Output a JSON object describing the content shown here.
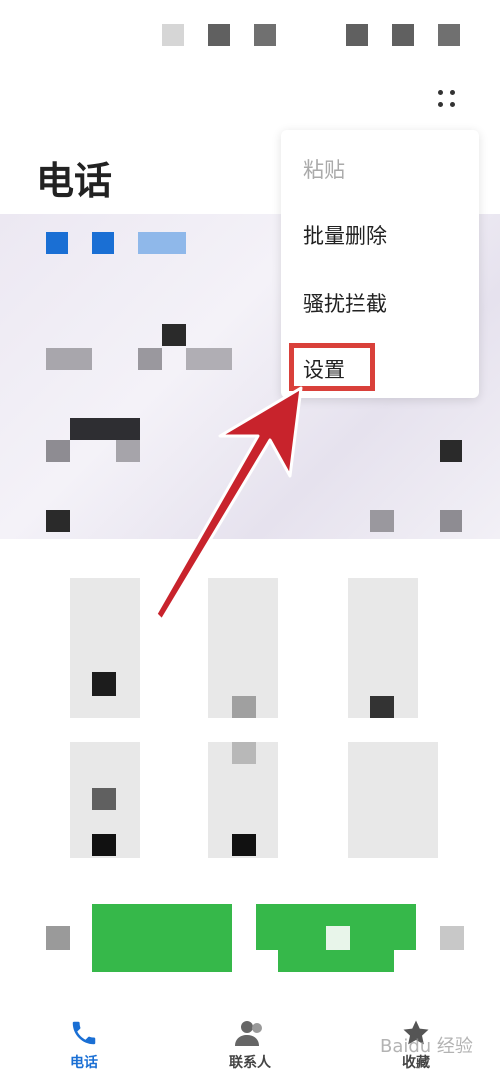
{
  "header": {
    "title": "电话"
  },
  "menu": {
    "items": [
      {
        "label": "粘贴",
        "enabled": false
      },
      {
        "label": "批量删除",
        "enabled": true
      },
      {
        "label": "骚扰拦截",
        "enabled": true
      },
      {
        "label": "设置",
        "enabled": true,
        "highlighted": true
      }
    ]
  },
  "bottom_nav": {
    "items": [
      {
        "label": "电话",
        "icon": "phone-icon",
        "active": true
      },
      {
        "label": "联系人",
        "icon": "contacts-icon",
        "active": false
      },
      {
        "label": "收藏",
        "icon": "star-icon",
        "active": false
      }
    ]
  },
  "watermark": {
    "text": "Baidu 经验"
  },
  "colors": {
    "accent": "#1a6fd4",
    "highlight": "#d9403a",
    "call_green": "#36b84a",
    "arrow_red": "#c8232c"
  }
}
